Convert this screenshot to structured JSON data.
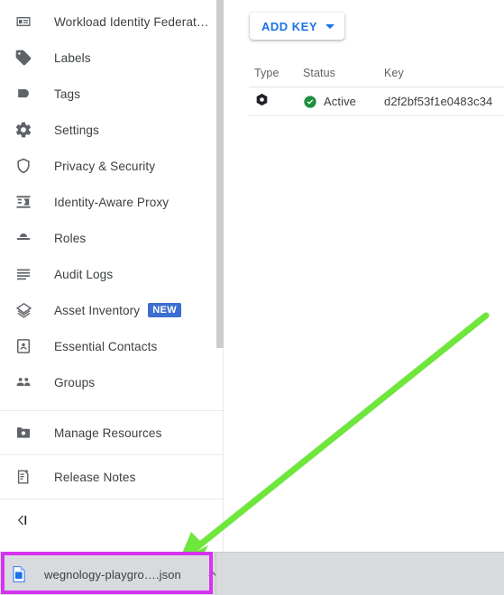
{
  "sidebar": {
    "items": [
      {
        "label": "Workload Identity Federat…",
        "icon": "workload-identity-icon",
        "badge": null
      },
      {
        "label": "Labels",
        "icon": "label-tag-icon",
        "badge": null
      },
      {
        "label": "Tags",
        "icon": "tag-flag-icon",
        "badge": null
      },
      {
        "label": "Settings",
        "icon": "gear-icon",
        "badge": null
      },
      {
        "label": "Privacy & Security",
        "icon": "shield-icon",
        "badge": null
      },
      {
        "label": "Identity-Aware Proxy",
        "icon": "identity-aware-proxy-icon",
        "badge": null
      },
      {
        "label": "Roles",
        "icon": "roles-hat-icon",
        "badge": null
      },
      {
        "label": "Audit Logs",
        "icon": "audit-logs-lines-icon",
        "badge": null
      },
      {
        "label": "Asset Inventory",
        "icon": "asset-inventory-layers-icon",
        "badge": "NEW"
      },
      {
        "label": "Essential Contacts",
        "icon": "essential-contacts-icon",
        "badge": null
      },
      {
        "label": "Groups",
        "icon": "groups-people-icon",
        "badge": null
      }
    ],
    "secondary_items": [
      {
        "label": "Manage Resources",
        "icon": "manage-resources-folder-icon"
      },
      {
        "label": "Release Notes",
        "icon": "release-notes-document-icon"
      }
    ],
    "collapse": {
      "icon": "collapse-panel-icon",
      "label": ""
    },
    "badge_color": "#3c6ed0"
  },
  "main": {
    "add_key_button": {
      "label": "ADD KEY",
      "caret": "chevron-down-icon",
      "color": "#1a73e8"
    },
    "table": {
      "columns": [
        "Type",
        "Status",
        "Key"
      ],
      "rows": [
        {
          "type_icon": "key-hex-icon",
          "status": "Active",
          "status_icon": "check-circle-icon",
          "status_color": "#1e8e3e",
          "key": "d2f2bf53f1e0483c34"
        }
      ]
    }
  },
  "annotation": {
    "arrow_color": "#6ee63c",
    "highlight_color": "#d633f0"
  },
  "download_bar": {
    "file_name": "wegnology-playgro….json",
    "file_icon": "json-file-icon",
    "chevron": "chevron-up-icon"
  }
}
